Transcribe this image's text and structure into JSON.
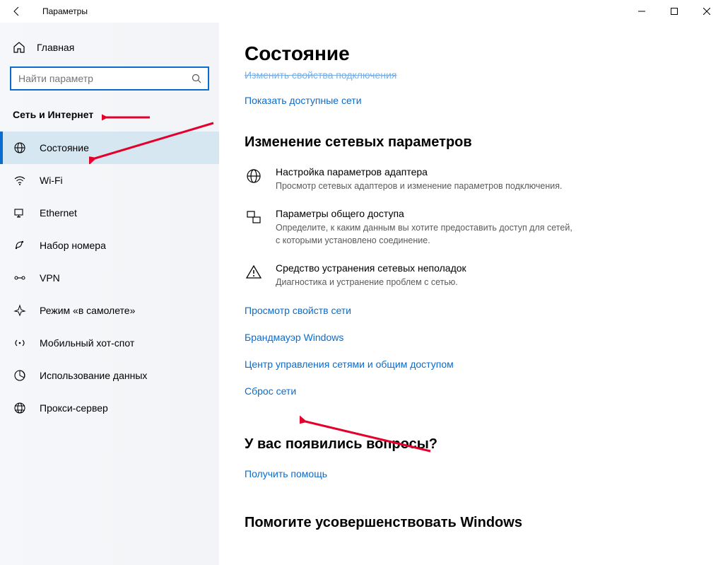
{
  "titlebar": {
    "title": "Параметры"
  },
  "sidebar": {
    "home": "Главная",
    "search_placeholder": "Найти параметр",
    "category": "Сеть и Интернет",
    "items": [
      {
        "label": "Состояние"
      },
      {
        "label": "Wi-Fi"
      },
      {
        "label": "Ethernet"
      },
      {
        "label": "Набор номера"
      },
      {
        "label": "VPN"
      },
      {
        "label": "Режим «в самолете»"
      },
      {
        "label": "Мобильный хот-спот"
      },
      {
        "label": "Использование данных"
      },
      {
        "label": "Прокси-сервер"
      }
    ]
  },
  "main": {
    "title": "Состояние",
    "clipped": "Изменить свойства подключения",
    "show_networks": "Показать доступные сети",
    "section_change": "Изменение сетевых параметров",
    "cards": [
      {
        "title": "Настройка параметров адаптера",
        "desc": "Просмотр сетевых адаптеров и изменение параметров подключения."
      },
      {
        "title": "Параметры общего доступа",
        "desc": "Определите, к каким данным вы хотите предоставить доступ для сетей, с которыми установлено соединение."
      },
      {
        "title": "Средство устранения сетевых неполадок",
        "desc": "Диагностика и устранение проблем с сетью."
      }
    ],
    "links": [
      "Просмотр свойств сети",
      "Брандмауэр Windows",
      "Центр управления сетями и общим доступом",
      "Сброс сети"
    ],
    "question_title": "У вас появились вопросы?",
    "question_link": "Получить помощь",
    "feedback_title": "Помогите усовершенствовать Windows"
  }
}
